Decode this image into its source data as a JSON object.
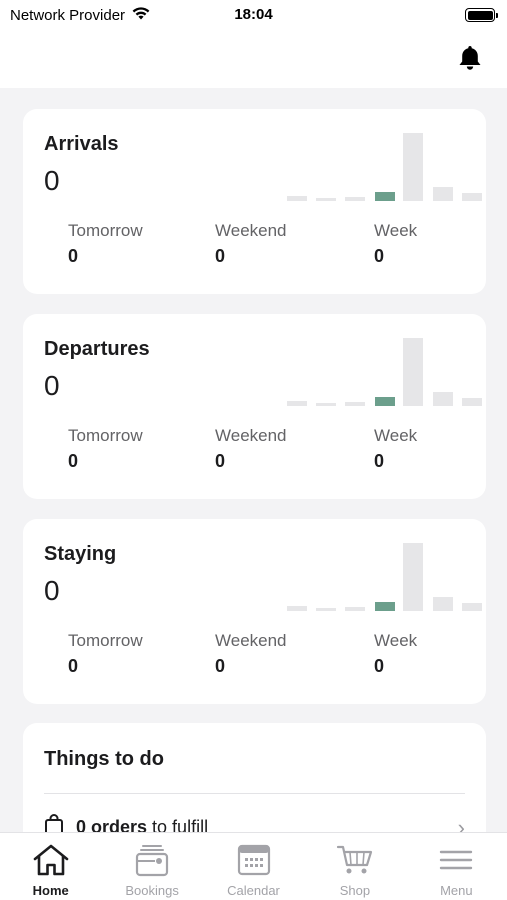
{
  "status_bar": {
    "carrier": "Network Provider",
    "time": "18:04"
  },
  "header": {
    "icon": "bell-icon"
  },
  "cards": [
    {
      "title": "Arrivals",
      "count": "0",
      "bars": [
        0.08,
        0.03,
        0.06,
        0.13,
        1.0,
        0.2,
        0.12
      ],
      "highlight_index": 3,
      "stats": [
        {
          "label": "Tomorrow",
          "value": "0"
        },
        {
          "label": "Weekend",
          "value": "0"
        },
        {
          "label": "Week",
          "value": "0"
        }
      ]
    },
    {
      "title": "Departures",
      "count": "0",
      "bars": [
        0.08,
        0.03,
        0.06,
        0.13,
        1.0,
        0.2,
        0.12
      ],
      "highlight_index": 3,
      "stats": [
        {
          "label": "Tomorrow",
          "value": "0"
        },
        {
          "label": "Weekend",
          "value": "0"
        },
        {
          "label": "Week",
          "value": "0"
        }
      ]
    },
    {
      "title": "Staying",
      "count": "0",
      "bars": [
        0.08,
        0.03,
        0.06,
        0.13,
        1.0,
        0.2,
        0.12
      ],
      "highlight_index": 3,
      "stats": [
        {
          "label": "Tomorrow",
          "value": "0"
        },
        {
          "label": "Weekend",
          "value": "0"
        },
        {
          "label": "Week",
          "value": "0"
        }
      ]
    }
  ],
  "todo": {
    "title": "Things to do",
    "items": [
      {
        "bold": "0 orders",
        "rest": "to fulfill"
      }
    ]
  },
  "tabs": [
    {
      "label": "Home",
      "icon": "home-icon",
      "active": true
    },
    {
      "label": "Bookings",
      "icon": "bookings-icon",
      "active": false
    },
    {
      "label": "Calendar",
      "icon": "calendar-icon",
      "active": false
    },
    {
      "label": "Shop",
      "icon": "cart-icon",
      "active": false
    },
    {
      "label": "Menu",
      "icon": "menu-icon",
      "active": false
    }
  ],
  "colors": {
    "accent_green": "#6c9f8c",
    "bar_gray": "#e6e6e8",
    "background": "#f3f3f5"
  }
}
